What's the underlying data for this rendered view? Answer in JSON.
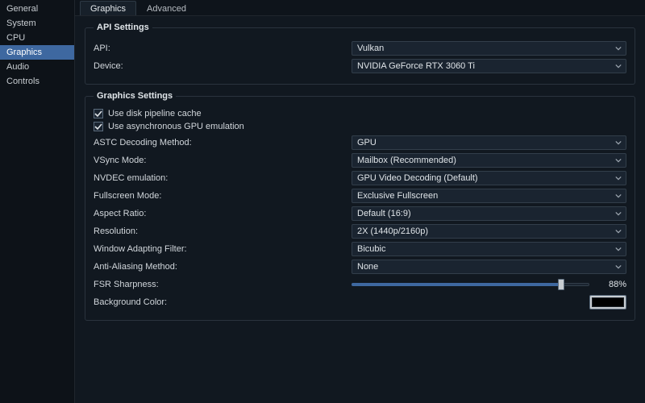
{
  "sidebar": {
    "items": [
      {
        "label": "General"
      },
      {
        "label": "System"
      },
      {
        "label": "CPU"
      },
      {
        "label": "Graphics"
      },
      {
        "label": "Audio"
      },
      {
        "label": "Controls"
      }
    ],
    "active_index": 3
  },
  "tabs": {
    "items": [
      {
        "label": "Graphics"
      },
      {
        "label": "Advanced"
      }
    ],
    "active_index": 0
  },
  "api_settings": {
    "legend": "API Settings",
    "api_label": "API:",
    "api_value": "Vulkan",
    "device_label": "Device:",
    "device_value": "NVIDIA GeForce RTX 3060 Ti"
  },
  "gfx_settings": {
    "legend": "Graphics Settings",
    "disk_cache_label": "Use disk pipeline cache",
    "disk_cache_checked": true,
    "async_gpu_label": "Use asynchronous GPU emulation",
    "async_gpu_checked": true,
    "astc_label": "ASTC Decoding Method:",
    "astc_value": "GPU",
    "vsync_label": "VSync Mode:",
    "vsync_value": "Mailbox (Recommended)",
    "nvdec_label": "NVDEC emulation:",
    "nvdec_value": "GPU Video Decoding (Default)",
    "fullscreen_label": "Fullscreen Mode:",
    "fullscreen_value": "Exclusive Fullscreen",
    "aspect_label": "Aspect Ratio:",
    "aspect_value": "Default (16:9)",
    "resolution_label": "Resolution:",
    "resolution_value": "2X (1440p/2160p)",
    "waf_label": "Window Adapting Filter:",
    "waf_value": "Bicubic",
    "aa_label": "Anti-Aliasing Method:",
    "aa_value": "None",
    "fsr_label": "FSR Sharpness:",
    "fsr_value_pct": 88,
    "fsr_value_text": "88%",
    "bg_label": "Background Color:",
    "bg_color": "#000000"
  }
}
